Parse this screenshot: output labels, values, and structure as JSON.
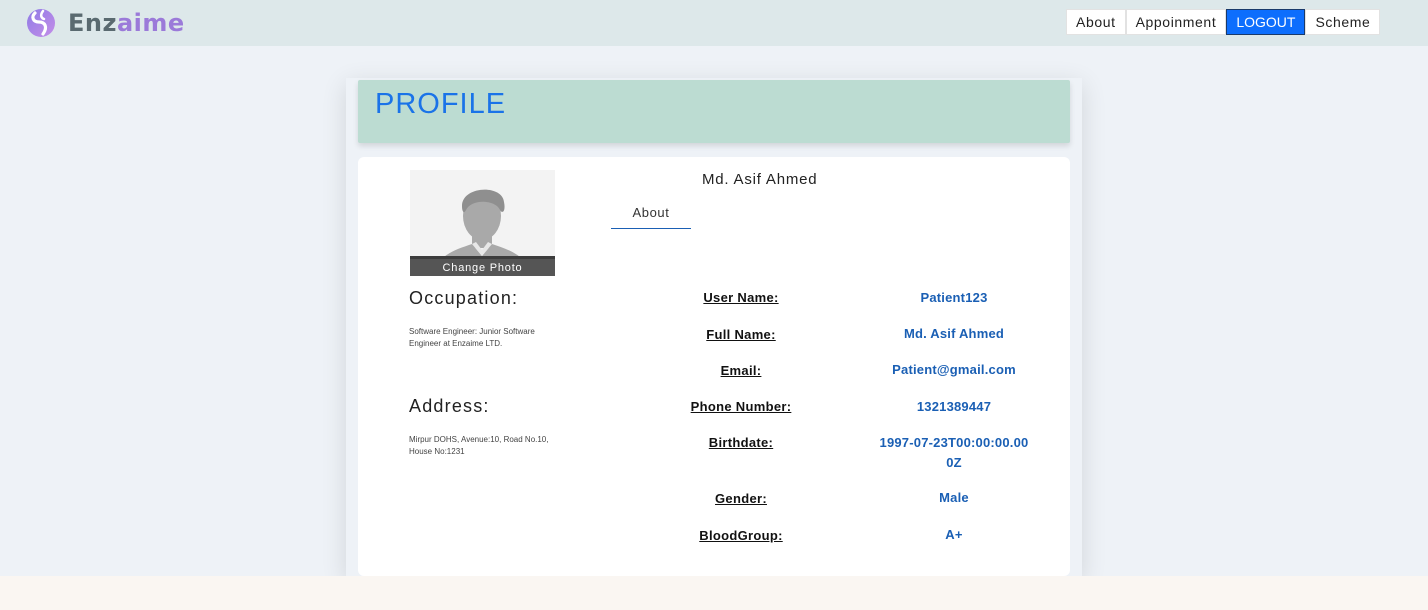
{
  "brand": {
    "name_part1": "Enz",
    "name_part2": "aime",
    "logo_icon": "enzaime-logo-icon"
  },
  "nav": {
    "items": [
      "About",
      "Appoinment",
      "LOGOUT",
      "Scheme"
    ],
    "active": "LOGOUT"
  },
  "page": {
    "title": "PROFILE"
  },
  "profile": {
    "name": "Md. Asif Ahmed",
    "tab": "About",
    "change_photo_label": "Change Photo",
    "avatar_icon": "user-avatar-placeholder-icon"
  },
  "sidebar": {
    "occupation_heading": "Occupation:",
    "occupation_text": "Software Engineer: Junior Software Engineer at Enzaime LTD.",
    "address_heading": "Address:",
    "address_text": "Mirpur DOHS, Avenue:10, Road No.10, House No:1231"
  },
  "details": [
    {
      "label": "User Name:",
      "value": "Patient123"
    },
    {
      "label": "Full Name:",
      "value": "Md. Asif Ahmed"
    },
    {
      "label": "Email:",
      "value": "Patient@gmail.com"
    },
    {
      "label": "Phone Number:",
      "value": "1321389447"
    },
    {
      "label": "Birthdate:",
      "value": "1997-07-23T00:00:00.000Z"
    },
    {
      "label": "Gender:",
      "value": "Male"
    },
    {
      "label": "BloodGroup:",
      "value": "A+"
    }
  ],
  "colors": {
    "accent": "#0d6efd",
    "header_panel": "#bcdcd2",
    "value_text": "#1a5fb4",
    "topbar": "#dde8ea"
  }
}
